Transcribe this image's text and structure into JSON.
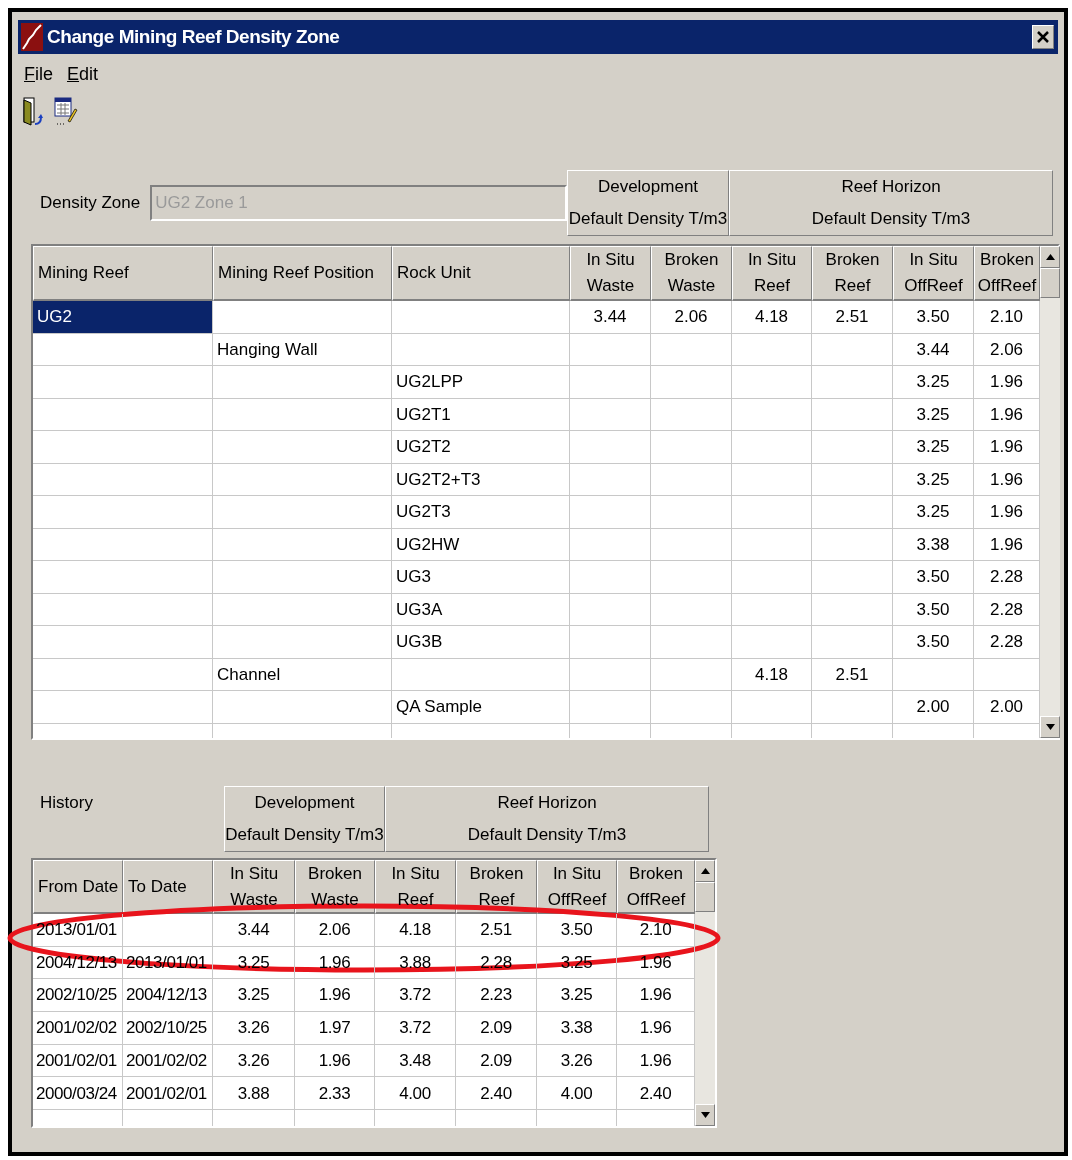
{
  "window": {
    "title": "Change Mining Reef Density Zone"
  },
  "menu": [
    {
      "label": "File"
    },
    {
      "label": "Edit"
    }
  ],
  "density_zone": {
    "label": "Density Zone",
    "value": "UG2 Zone 1",
    "disabled": true
  },
  "main_groups": [
    {
      "line1": "Development",
      "line2": "Default Density T/m3"
    },
    {
      "line1": "Reef Horizon",
      "line2": "Default Density T/m3"
    }
  ],
  "main_table": {
    "columns": [
      {
        "label": "Mining Reef",
        "kind": "text"
      },
      {
        "label": "Mining Reef Position",
        "kind": "text"
      },
      {
        "label": "Rock Unit",
        "kind": "text"
      },
      {
        "label": "In Situ Waste",
        "kind": "number"
      },
      {
        "label": "Broken Waste",
        "kind": "number"
      },
      {
        "label": "In Situ Reef",
        "kind": "number"
      },
      {
        "label": "Broken Reef",
        "kind": "number"
      },
      {
        "label": "In Situ OffReef",
        "kind": "number"
      },
      {
        "label": "Broken OffReef",
        "kind": "number"
      }
    ],
    "rows": [
      {
        "selected": true,
        "cells": [
          "UG2",
          null,
          null,
          "3.44",
          "2.06",
          "4.18",
          "2.51",
          "3.50",
          "2.10"
        ]
      },
      {
        "selected": false,
        "cells": [
          null,
          "Hanging Wall",
          null,
          null,
          null,
          null,
          null,
          "3.44",
          "2.06"
        ]
      },
      {
        "selected": false,
        "cells": [
          null,
          null,
          "UG2LPP",
          null,
          null,
          null,
          null,
          "3.25",
          "1.96"
        ]
      },
      {
        "selected": false,
        "cells": [
          null,
          null,
          "UG2T1",
          null,
          null,
          null,
          null,
          "3.25",
          "1.96"
        ]
      },
      {
        "selected": false,
        "cells": [
          null,
          null,
          "UG2T2",
          null,
          null,
          null,
          null,
          "3.25",
          "1.96"
        ]
      },
      {
        "selected": false,
        "cells": [
          null,
          null,
          "UG2T2+T3",
          null,
          null,
          null,
          null,
          "3.25",
          "1.96"
        ]
      },
      {
        "selected": false,
        "cells": [
          null,
          null,
          "UG2T3",
          null,
          null,
          null,
          null,
          "3.25",
          "1.96"
        ]
      },
      {
        "selected": false,
        "cells": [
          null,
          null,
          "UG2HW",
          null,
          null,
          null,
          null,
          "3.38",
          "1.96"
        ]
      },
      {
        "selected": false,
        "cells": [
          null,
          null,
          "UG3",
          null,
          null,
          null,
          null,
          "3.50",
          "2.28"
        ]
      },
      {
        "selected": false,
        "cells": [
          null,
          null,
          "UG3A",
          null,
          null,
          null,
          null,
          "3.50",
          "2.28"
        ]
      },
      {
        "selected": false,
        "cells": [
          null,
          null,
          "UG3B",
          null,
          null,
          null,
          null,
          "3.50",
          "2.28"
        ]
      },
      {
        "selected": false,
        "cells": [
          null,
          "Channel",
          null,
          null,
          null,
          "4.18",
          "2.51",
          null,
          null
        ]
      },
      {
        "selected": false,
        "cells": [
          null,
          null,
          "QA Sample",
          null,
          null,
          null,
          null,
          "2.00",
          "2.00"
        ]
      }
    ]
  },
  "history": {
    "label": "History",
    "groups": [
      {
        "line1": "Development",
        "line2": "Default Density T/m3"
      },
      {
        "line1": "Reef Horizon",
        "line2": "Default Density T/m3"
      }
    ],
    "columns": [
      {
        "label": "From Date",
        "kind": "text"
      },
      {
        "label": "To Date",
        "kind": "text"
      },
      {
        "label": "In Situ Waste",
        "kind": "number"
      },
      {
        "label": "Broken Waste",
        "kind": "number"
      },
      {
        "label": "In Situ Reef",
        "kind": "number"
      },
      {
        "label": "Broken Reef",
        "kind": "number"
      },
      {
        "label": "In Situ OffReef",
        "kind": "number"
      },
      {
        "label": "Broken OffReef",
        "kind": "number"
      }
    ],
    "rows": [
      [
        "2013/01/01",
        null,
        "3.44",
        "2.06",
        "4.18",
        "2.51",
        "3.50",
        "2.10"
      ],
      [
        "2004/12/13",
        "2013/01/01",
        "3.25",
        "1.96",
        "3.88",
        "2.28",
        "3.25",
        "1.96"
      ],
      [
        "2002/10/25",
        "2004/12/13",
        "3.25",
        "1.96",
        "3.72",
        "2.23",
        "3.25",
        "1.96"
      ],
      [
        "2001/02/02",
        "2002/10/25",
        "3.26",
        "1.97",
        "3.72",
        "2.09",
        "3.38",
        "1.96"
      ],
      [
        "2001/02/01",
        "2001/02/02",
        "3.26",
        "1.96",
        "3.48",
        "2.09",
        "3.26",
        "1.96"
      ],
      [
        "2000/03/24",
        "2001/02/01",
        "3.88",
        "2.33",
        "4.00",
        "2.40",
        "4.00",
        "2.40"
      ]
    ]
  }
}
